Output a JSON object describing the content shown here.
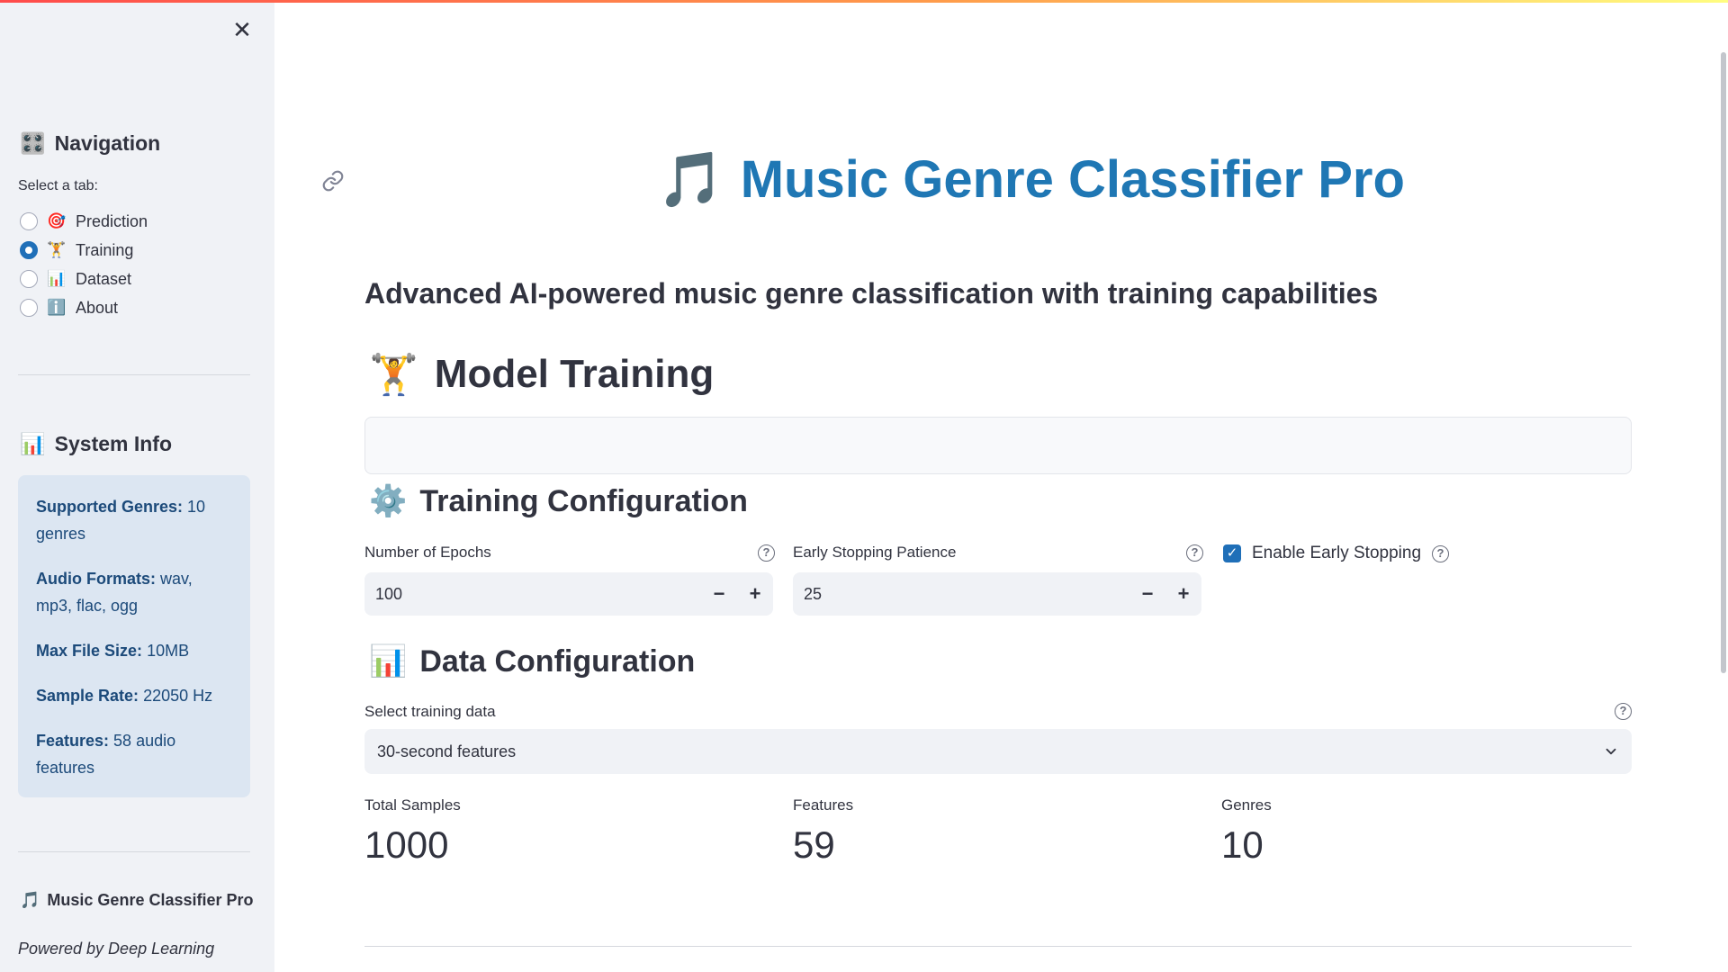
{
  "sidebar": {
    "nav_title": "Navigation",
    "nav_icon": "🎛️",
    "select_label": "Select a tab:",
    "tabs": [
      {
        "icon": "🎯",
        "label": "Prediction",
        "selected": false
      },
      {
        "icon": "🏋️",
        "label": "Training",
        "selected": true
      },
      {
        "icon": "📊",
        "label": "Dataset",
        "selected": false
      },
      {
        "icon": "ℹ️",
        "label": "About",
        "selected": false
      }
    ],
    "sysinfo_title": "System Info",
    "sysinfo_icon": "📊",
    "info": [
      {
        "key": "Supported Genres:",
        "value": "10 genres"
      },
      {
        "key": "Audio Formats:",
        "value": "wav, mp3, flac, ogg"
      },
      {
        "key": "Max File Size:",
        "value": "10MB"
      },
      {
        "key": "Sample Rate:",
        "value": "22050 Hz"
      },
      {
        "key": "Features:",
        "value": "58 audio features"
      }
    ],
    "footer_icon": "🎵",
    "footer_title": "Music Genre Classifier Pro",
    "footer_sub": "Powered by Deep Learning"
  },
  "main": {
    "title_icon": "🎵",
    "title": "Music Genre Classifier Pro",
    "subtitle": "Advanced AI-powered music genre classification with training capabilities",
    "section_icon": "🏋️",
    "section_title": "Model Training",
    "training_config": {
      "icon": "⚙️",
      "title": "Training Configuration",
      "epochs_label": "Number of Epochs",
      "epochs_value": "100",
      "patience_label": "Early Stopping Patience",
      "patience_value": "25",
      "early_stopping_label": "Enable Early Stopping",
      "early_stopping_checked": true
    },
    "data_config": {
      "icon": "📊",
      "title": "Data Configuration",
      "select_label": "Select training data",
      "selected_value": "30-second features"
    },
    "metrics": [
      {
        "label": "Total Samples",
        "value": "1000"
      },
      {
        "label": "Features",
        "value": "59"
      },
      {
        "label": "Genres",
        "value": "10"
      }
    ]
  },
  "colors": {
    "accent": "#1f6fb8",
    "title": "#1f77b4",
    "sidebar_bg": "#f0f2f6",
    "info_bg": "#dce6f2"
  }
}
